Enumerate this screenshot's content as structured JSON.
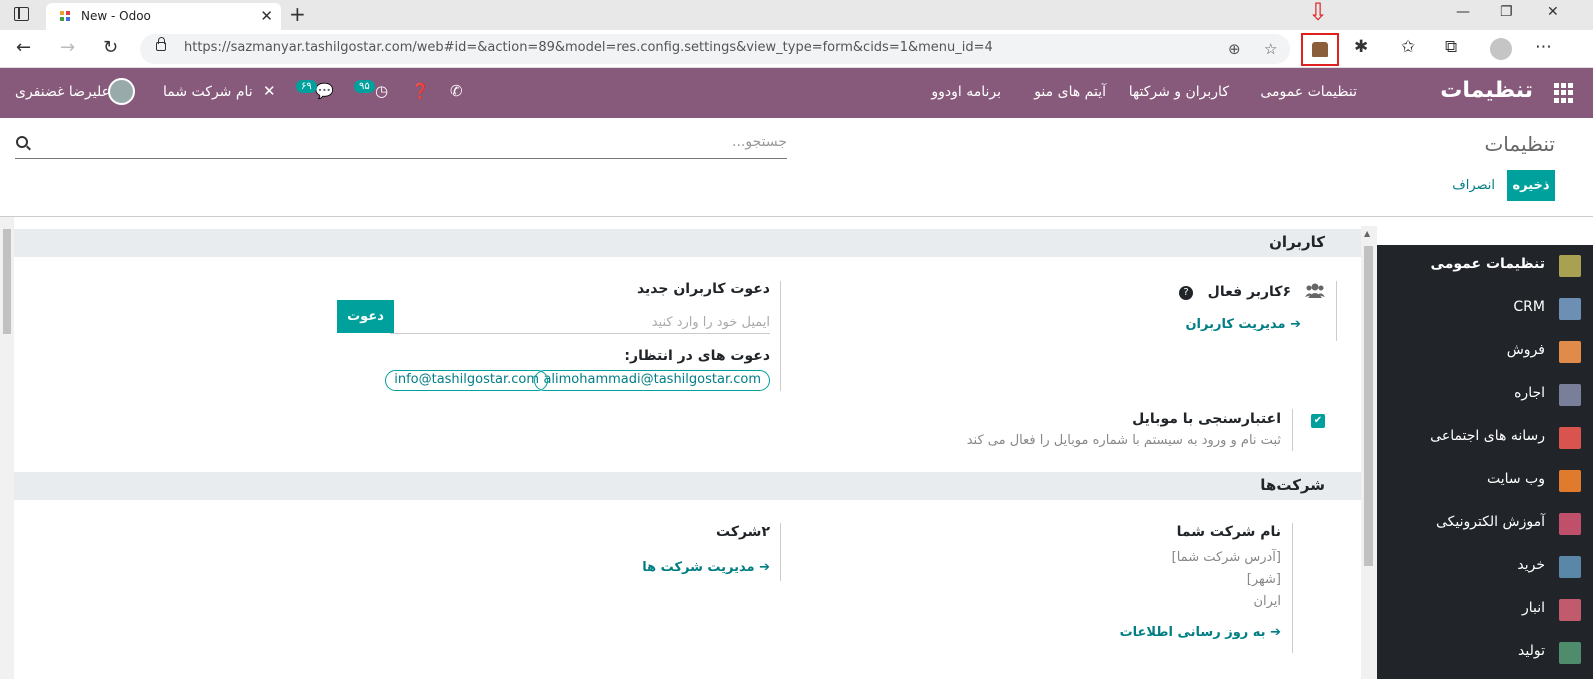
{
  "browser": {
    "tab_title": "New - Odoo",
    "url": "https://sazmanyar.tashilgostar.com/web#id=&action=89&model=res.config.settings&view_type=form&cids=1&menu_id=4"
  },
  "navbar": {
    "brand": "تنظیمات",
    "menu": [
      "تنظیمات عمومی",
      "کاربران و شرکتها",
      "آیتم های منو",
      "برنامه اودوو"
    ],
    "activities_count": "۹۵",
    "messages_count": "۶۹",
    "company_name": "نام شرکت شما",
    "user_name": "علیرضا غضنفری"
  },
  "control_panel": {
    "breadcrumb": "تنظیمات",
    "search_placeholder": "جستجو...",
    "save_label": "ذخیره",
    "discard_label": "انصراف"
  },
  "sections": {
    "users": {
      "title": "کاربران",
      "active_users": "۶کاربر فعال",
      "manage_users": "مدیریت کاربران",
      "invite_title": "دعوت کاربران جدید",
      "invite_placeholder": "ایمیل خود را وارد کنید",
      "invite_button": "دعوت",
      "pending_title": "دعوت های در انتظار:",
      "pending": [
        "alimohammadi@tashilgostar.com",
        "info@tashilgostar.com"
      ],
      "mobile_auth_title": "اعتبارسنجی با موبایل",
      "mobile_auth_desc": "ثبت نام و ورود به سیستم با شماره موبایل را فعال می کند"
    },
    "companies": {
      "title": "شرکت‌ها",
      "company_name": "نام شرکت شما",
      "address": "[آدرس شرکت شما]",
      "city": "[شهر]",
      "country": "ایران",
      "update_info": "به روز رسانی اطلاعات",
      "companies_count": "۲شرکت",
      "manage_companies": "مدیریت شرکت ها"
    }
  },
  "sidebar": {
    "items": [
      {
        "label": "تنظیمات عمومی",
        "icon": "gear-icon",
        "color": "#a8a152"
      },
      {
        "label": "CRM",
        "icon": "handshake-icon",
        "color": "#6d8fb3"
      },
      {
        "label": "فروش",
        "icon": "chart-icon",
        "color": "#e08b4a"
      },
      {
        "label": "اجاره",
        "icon": "rental-icon",
        "color": "#7a7f99"
      },
      {
        "label": "رسانه های اجتماعی",
        "icon": "thumbs-up-icon",
        "color": "#d9534f"
      },
      {
        "label": "وب سایت",
        "icon": "globe-icon",
        "color": "#e07b2e"
      },
      {
        "label": "آموزش الکترونیکی",
        "icon": "elearning-icon",
        "color": "#c0506a"
      },
      {
        "label": "خرید",
        "icon": "credit-card-icon",
        "color": "#5a86a8"
      },
      {
        "label": "انبار",
        "icon": "box-icon",
        "color": "#c25a6e"
      },
      {
        "label": "تولید",
        "icon": "wrench-icon",
        "color": "#4e8c6b"
      }
    ]
  }
}
